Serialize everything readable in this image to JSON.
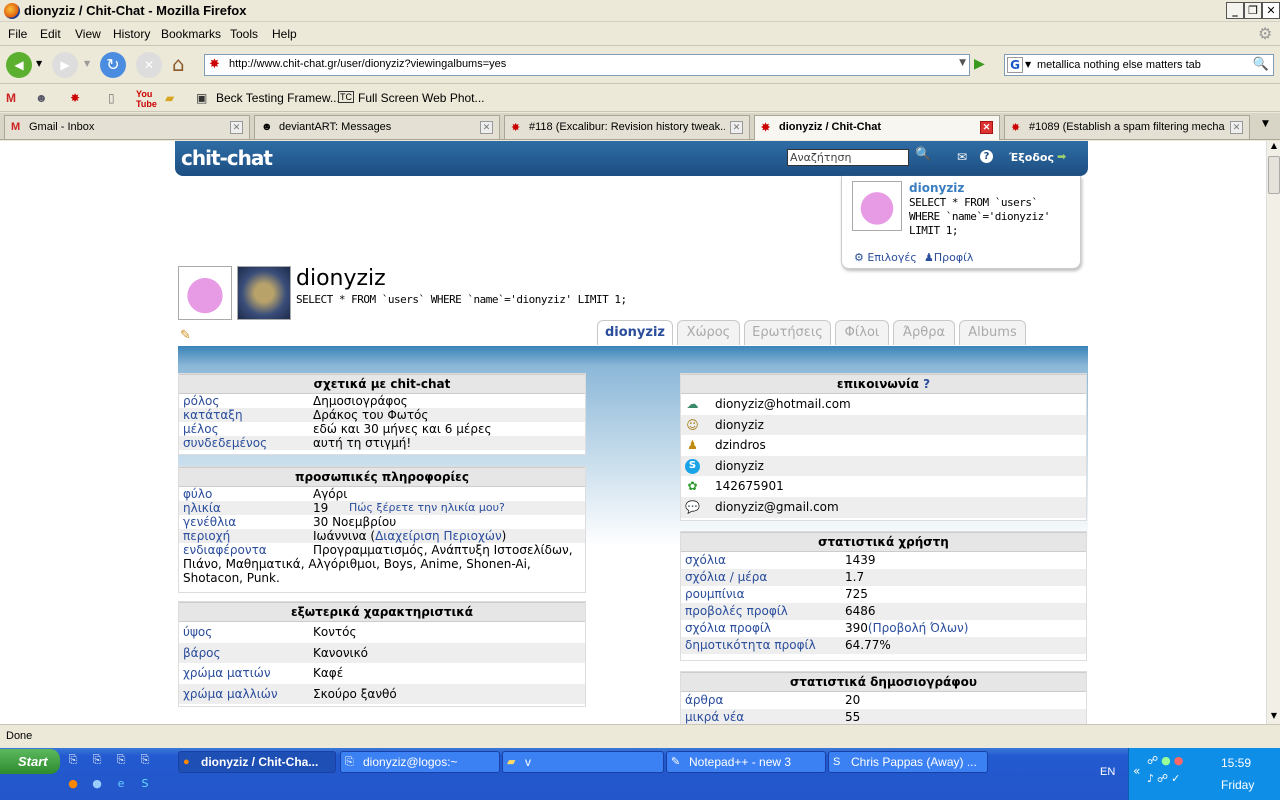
{
  "window": {
    "title": "dionyziz / Chit-Chat - Mozilla Firefox"
  },
  "menu": [
    "File",
    "Edit",
    "View",
    "History",
    "Bookmarks",
    "Tools",
    "Help"
  ],
  "nav": {
    "url": "http://www.chit-chat.gr/user/dionyziz?viewingalbums=yes",
    "search": "metallica nothing else matters tab"
  },
  "bookmarks": [
    "Beck Testing Framew...",
    "Full Screen Web Phot..."
  ],
  "tabs": [
    {
      "label": "Gmail - Inbox",
      "icon": "M"
    },
    {
      "label": "deviantART: Messages",
      "icon": "☻"
    },
    {
      "label": "#118 (Excalibur: Revision history tweak...",
      "icon": "✸"
    },
    {
      "label": "dionyziz / Chit-Chat",
      "icon": "✸"
    },
    {
      "label": "#1089 (Establish a spam filtering mecha...",
      "icon": "✸"
    }
  ],
  "site": {
    "logo": "chit-chat",
    "search_placeholder": "Αναζήτηση",
    "logout": "Έξοδος",
    "userbox": {
      "name": "dionyziz",
      "sql": "SELECT * FROM `users` WHERE `name`='dionyziz' LIMIT 1;",
      "options": "Επιλογές",
      "profile": "Προφίλ"
    }
  },
  "profile": {
    "name": "dionyziz",
    "sql": "SELECT * FROM `users` WHERE `name`='dionyziz' LIMIT 1;",
    "tabs": [
      "dionyziz",
      "Χώρος",
      "Ερωτήσεις",
      "Φίλοι",
      "Άρθρα",
      "Albums"
    ],
    "about": {
      "title": "σχετικά με chit-chat",
      "rows": [
        [
          "ρόλος",
          "Δημοσιογράφος"
        ],
        [
          "κατάταξη",
          "Δράκος του Φωτός"
        ],
        [
          "μέλος",
          "εδώ και 30 μήνες και 6 μέρες"
        ],
        [
          "συνδεδεμένος",
          "αυτή τη στιγμή!"
        ]
      ]
    },
    "personal": {
      "title": "προσωπικές πληροφορίες",
      "sex": [
        "φύλο",
        "Αγόρι"
      ],
      "age": [
        "ηλικία",
        "19"
      ],
      "age_link": "Πώς ξέρετε την ηλικία μου?",
      "birthday": [
        "γενέθλια",
        "30 Νοεμβρίου"
      ],
      "area": [
        "περιοχή",
        "Ιωάννινα ("
      ],
      "area_link": "Διαχείριση Περιοχών",
      "area_end": ")",
      "interests_key": "ενδιαφέροντα",
      "interests_line1": "Προγραμματισμός, Ανάπτυξη Ιστοσελίδων,",
      "interests_line2": "Πιάνο, Μαθηματικά, Αλγόριθμοι, Boys, Anime, Shonen-Ai,",
      "interests_line3": "Shotacon, Punk."
    },
    "physical": {
      "title": "εξωτερικά χαρακτηριστικά",
      "rows": [
        [
          "ύψος",
          "Κοντός"
        ],
        [
          "βάρος",
          "Κανονικό"
        ],
        [
          "χρώμα ματιών",
          "Καφέ"
        ],
        [
          "χρώμα μαλλιών",
          "Σκούρο ξανθό"
        ]
      ]
    },
    "contact": {
      "title": "επικοινωνία",
      "help": "?",
      "rows": [
        {
          "icon": "msn-icon",
          "glyph": "☁",
          "value": "dionyziz@hotmail.com"
        },
        {
          "icon": "yahoo-icon",
          "glyph": "☺",
          "value": "dionyziz"
        },
        {
          "icon": "aim-icon",
          "glyph": "♟",
          "value": "dzindros"
        },
        {
          "icon": "skype-icon",
          "glyph": "S",
          "value": "dionyziz"
        },
        {
          "icon": "icq-icon",
          "glyph": "✿",
          "value": "142675901"
        },
        {
          "icon": "gtalk-icon",
          "glyph": "💬",
          "value": "dionyziz@gmail.com"
        }
      ]
    },
    "stats": {
      "title": "στατιστικά χρήστη",
      "rows": [
        [
          "σχόλια",
          "1439"
        ],
        [
          "σχόλια / μέρα",
          "1.7"
        ],
        [
          "ρουμπίνια",
          "725"
        ],
        [
          "προβολές προφίλ",
          "6486"
        ],
        [
          "σχόλια προφίλ",
          "390"
        ],
        [
          "δημοτικότητα προφίλ",
          "64.77%"
        ]
      ],
      "view_all": "(Προβολή Όλων)"
    },
    "journalist": {
      "title": "στατιστικά δημοσιογράφου",
      "rows": [
        [
          "άρθρα",
          "20"
        ],
        [
          "μικρά νέα",
          "55"
        ]
      ]
    }
  },
  "status": "Done",
  "taskbar": {
    "start": "Start",
    "tasks": [
      "dionyziz / Chit-Cha...",
      "dionyziz@logos:~",
      "v",
      "Notepad++ - new 3",
      "Chris Pappas (Away) ..."
    ],
    "lang": "EN",
    "time": "15:59",
    "day": "Friday"
  },
  "colors": {
    "header_blue": "#1d4e82",
    "link": "#2a4d9c",
    "taskbar": "#235ad0"
  }
}
